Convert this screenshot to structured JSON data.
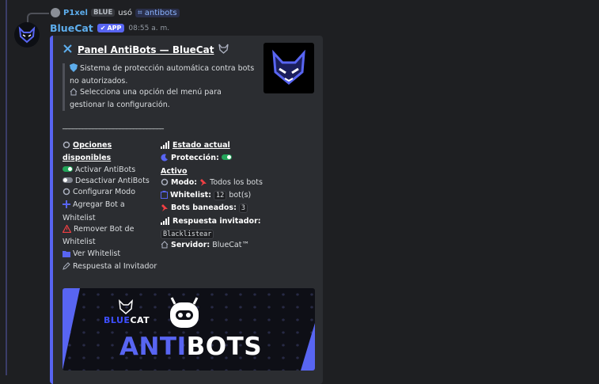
{
  "reply": {
    "user": "P1xel",
    "tag": "BLUE",
    "verb": "usó",
    "command": "antibots"
  },
  "message": {
    "author": "BlueCat",
    "app_badge": "APP",
    "time": "08:55 a. m."
  },
  "embed": {
    "title": "Panel AntiBots — BlueCat",
    "description_1": "Sistema de protección automática contra bots no autorizados.",
    "description_2": "Selecciona una opción del menú para gestionar la configuración.",
    "rule": "______________________________",
    "options": {
      "heading_1": "Opciones",
      "heading_2": "disponibles",
      "items": [
        "Activar AntiBots",
        "Desactivar AntiBots",
        "Configurar Modo",
        "Agregar Bot a Whitelist",
        "Remover Bot de Whitelist",
        "Ver Whitelist",
        "Respuesta al Invitador"
      ]
    },
    "status": {
      "heading": "Estado actual",
      "protection_label": "Protección:",
      "protection_value": "Activo",
      "mode_label": "Modo:",
      "mode_value": "Todos los bots",
      "whitelist_label": "Whitelist:",
      "whitelist_count": "12",
      "whitelist_unit": "bot(s)",
      "banned_label": "Bots baneados:",
      "banned_count": "3",
      "response_label": "Respuesta invitador:",
      "response_value": "Blacklistear",
      "server_label": "Servidor:",
      "server_value": "BlueCat™"
    },
    "banner": {
      "brand_a": "BLUE",
      "brand_b": "CAT",
      "title_a": "ANTI",
      "title_b": "BOTS"
    }
  },
  "colors": {
    "accent": "#5865f2",
    "author": "#5dadec",
    "background": "#1e1f22",
    "embed": "#2b2d31"
  }
}
